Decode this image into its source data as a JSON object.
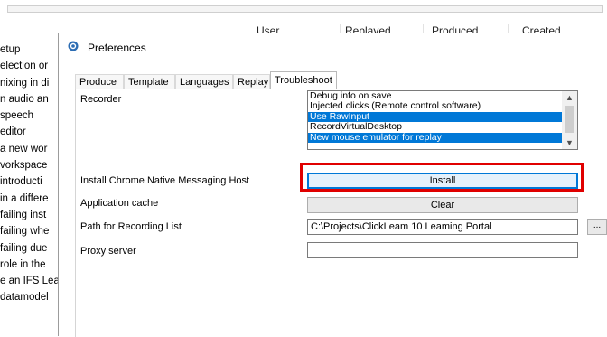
{
  "background": {
    "columns": [
      "User",
      "Replayed",
      "Produced",
      "Created"
    ],
    "list_items": [
      "etup",
      "election or",
      "nixing in di",
      "n audio an",
      "speech",
      " editor",
      "a new wor",
      "vorkspace",
      " introducti",
      "in a differe",
      "failing inst",
      "failing whe",
      "failing due",
      "role in the",
      "e an IFS Lea",
      "datamodel"
    ]
  },
  "dialog": {
    "title": "Preferences",
    "title_icon": "preferences-app-icon",
    "tabs": [
      "Produce",
      "Template",
      "Languages",
      "Replay",
      "Troubleshoot"
    ],
    "active_tab": "Troubleshoot"
  },
  "troubleshoot": {
    "recorder_label": "Recorder",
    "recorder_options": [
      {
        "label": "Debug info on save",
        "selected": false
      },
      {
        "label": "Injected clicks (Remote control software)",
        "selected": false
      },
      {
        "label": "Use RawInput",
        "selected": true
      },
      {
        "label": "RecordVirtualDesktop",
        "selected": false
      },
      {
        "label": "New mouse emulator for replay",
        "selected": true
      }
    ],
    "native_host_label": "Install Chrome Native Messaging Host",
    "install_button": "Install",
    "cache_label": "Application cache",
    "clear_button": "Clear",
    "path_label": "Path for Recording List",
    "path_value": "C:\\Projects\\ClickLeam 10 Leaming Portal",
    "browse_button": "...",
    "proxy_label": "Proxy server",
    "proxy_value": ""
  },
  "colors": {
    "selection": "#0078d7",
    "highlight_box": "#e00000"
  }
}
